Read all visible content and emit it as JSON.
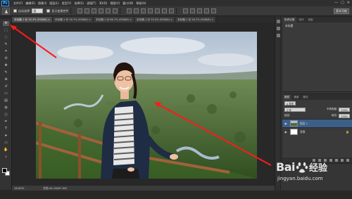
{
  "app": {
    "logo": "Ps",
    "menu": [
      "文件(F)",
      "编辑(E)",
      "图像(I)",
      "图层(L)",
      "类型(Y)",
      "选择(S)",
      "滤镜(T)",
      "3D(D)",
      "视图(V)",
      "窗口(W)",
      "帮助(H)"
    ],
    "window_controls": [
      "—",
      "□",
      "✕"
    ]
  },
  "options_bar": {
    "auto_select_label": "自动选择:",
    "auto_select_value": "组",
    "show_transform_label": "显示变换控件",
    "workspace": "基本功能"
  },
  "tabs": [
    {
      "label": "未标题-1 @ 33.3% (RGB/8) ×",
      "active": true
    },
    {
      "label": "未标题-1 @ 16.7% (RGB/8) ×",
      "active": false
    },
    {
      "label": "未标题-1 @ 66.7% (RGB/8) ×",
      "active": false
    },
    {
      "label": "未标题-1 @ 33.3% (RGB/8) ×",
      "active": false
    },
    {
      "label": "未标题-1 @ 16.7% (RGB/8) ×",
      "active": false
    }
  ],
  "status": {
    "zoom": "16.85%",
    "doc_size": "文档:49.1M/97.9M"
  },
  "tools": [
    "move",
    "marquee",
    "lasso",
    "quick-select",
    "crop",
    "eyedropper",
    "healing",
    "brush",
    "clone",
    "history-brush",
    "eraser",
    "gradient",
    "blur",
    "dodge",
    "pen",
    "type",
    "path-select",
    "shape",
    "hand",
    "zoom"
  ],
  "history_panel": {
    "tabs": [
      "历史记录",
      "动作",
      "色板"
    ],
    "snapshot": "未标题"
  },
  "layers_panel": {
    "tabs": [
      "图层",
      "通道",
      "路径"
    ],
    "kind": "ρ 类型",
    "blend_mode": "正常",
    "opacity_label": "不透明度:",
    "opacity_value": "100%",
    "lock_label": "锁定:",
    "fill_label": "填充:",
    "fill_value": "100%",
    "layers": [
      {
        "name": "图层 1",
        "selected": true
      },
      {
        "name": "背景",
        "selected": false
      }
    ]
  },
  "watermark": {
    "left": "Bai",
    "right": "经验",
    "url": "jingyan.baidu.com"
  },
  "colors": {
    "accent": "#2fa3ff",
    "selected_layer": "#3c5f88",
    "arrow": "#ff1a1a"
  }
}
